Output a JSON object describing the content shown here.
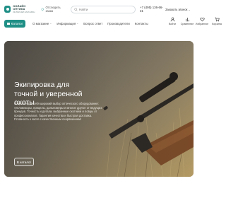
{
  "header": {
    "logo": {
      "title": "ОНЛАЙН ОПТИКА",
      "subtitle": "ИНТЕРНЕТ-МАГАЗИН"
    },
    "order_track": "Отследить заказ",
    "search": {
      "placeholder": "Найти"
    },
    "phone": "+7 (495) 136-66-31",
    "callback": "Заказать звонок",
    "callback_chevron": "⌄"
  },
  "nav": {
    "catalog_label": "Каталог",
    "links": [
      {
        "label": "О магазине",
        "chevron": "⌄"
      },
      {
        "label": "Информация",
        "chevron": "⌄"
      },
      {
        "label": "Вопрос ответ",
        "chevron": ""
      },
      {
        "label": "Производители",
        "chevron": ""
      },
      {
        "label": "Контакты",
        "chevron": ""
      }
    ]
  },
  "tools": [
    {
      "label": "Войти",
      "icon": "user-icon"
    },
    {
      "label": "Сравнение",
      "icon": "compare-icon"
    },
    {
      "label": "Избранное",
      "icon": "heart-icon"
    },
    {
      "label": "Корзина",
      "icon": "cart-icon"
    }
  ],
  "hero": {
    "title": "Экипировка для точной и уверенной охоты",
    "description": "Откройте для себя широкий выбор оптического оборудования: тепловизоры, прицелы, дальномеры и многое другое от ведущих брендов. Точность и детали, выбранные охотники и ловцы от профессионалов. Гарантия качества и быстрая доставка. Готовность к охоте с качественным снаряжением!",
    "button_label": "В каталог"
  },
  "colors": {
    "accent": "#1f8f86"
  }
}
